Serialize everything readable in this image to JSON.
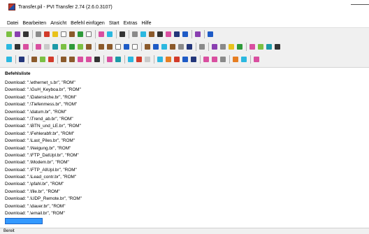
{
  "window": {
    "title": "Transfer.pil - PVI Transfer 2.74 (2.6.0.3107)",
    "app_icon": "pvi-transfer-icon"
  },
  "menubar": {
    "items": [
      "Datei",
      "Bearbeiten",
      "Ansicht",
      "Befehl einfügen",
      "Start",
      "Extras",
      "Hilfe"
    ]
  },
  "toolbars": {
    "row1": [
      "new-file-icon",
      "open-folder-icon",
      "save-icon",
      "sep",
      "cut-icon",
      "copy-icon",
      "paste-icon",
      "check-icon",
      "delete-icon",
      "undo-icon",
      "enter-icon",
      "sep",
      "insert-plus-icon",
      "insert-minus-icon",
      "sep",
      "print-icon",
      "sep",
      "stop-icon",
      "warning-icon",
      "circle-check-icon",
      "pencil-icon",
      "network-icon",
      "connect-icon",
      "connect-alt-icon",
      "sep",
      "help-icon",
      "sep",
      "question-icon"
    ],
    "row2": [
      "tool-a-icon",
      "tool-b-icon",
      "tool-c-icon",
      "sep",
      "down-arrow-icon",
      "up-arrow-icon",
      "home-icon",
      "warning-triangle-icon",
      "bar-chart-icon",
      "wrench-icon",
      "file-bl-icon",
      "sep",
      "refresh-icon",
      "sync-icon",
      "search-icon",
      "stop-red-icon",
      "chat-icon",
      "sep",
      "run-icon",
      "grid-icon",
      "pie-icon",
      "user-icon",
      "layers-icon",
      "tag-icon",
      "sep",
      "star-icon",
      "sep",
      "frame-a-icon",
      "frame-b-icon",
      "frame-c-icon",
      "frame-d-icon",
      "sep",
      "check-green-icon",
      "check-yellow-icon",
      "key-icon",
      "magic-icon"
    ],
    "row3": [
      "module-icon",
      "sep",
      "monitor-icon",
      "sep",
      "lock-icon",
      "boxes-icon",
      "bolt-icon",
      "sep",
      "image-icon",
      "document-icon",
      "chart-icon",
      "layers-alt-icon",
      "network-tree-icon",
      "sep",
      "connect-a-icon",
      "connect-b-icon",
      "sep",
      "email-icon",
      "timer-icon",
      "ip-icon",
      "sep",
      "variable-icon",
      "window-icon",
      "nc-icon",
      "blocks-icon",
      "arrows-icon",
      "sep",
      "list-icon",
      "sort-icon",
      "check-mark-icon",
      "sep",
      "p-icon",
      "flag-icon",
      "sep",
      "table-icon"
    ]
  },
  "command_list": {
    "header": "Befehlsliste",
    "items": [
      "Download: \".\\ethernet_s.br\", \"ROM\"",
      "Download: \".\\GuH_Keyboa.br\", \"ROM\"",
      "Download: \".\\Datensiche.br\", \"ROM\"",
      "Download: \".\\Tiefenmess.br\", \"ROM\"",
      "Download: \".\\datum.br\", \"ROM\"",
      "Download: \".\\Trend_ab.br\", \"ROM\"",
      "Download: \".\\BTN_und_LE.br\", \"ROM\"",
      "Download: \".\\Fehlerabfr.br\", \"ROM\"",
      "Download: \".\\Last_Piles.br\", \"ROM\"",
      "Download: \".\\Neigung.br\", \"ROM\"",
      "Download: \".\\FTP_DatUpl.br\", \"ROM\"",
      "Download: \".\\Modem.br\", \"ROM\"",
      "Download: \".\\FTP_AllUpl.br\", \"ROM\"",
      "Download: \".\\Lead_contr.br\", \"ROM\"",
      "Download: \".\\pfahl.br\", \"ROM\"",
      "Download: \".\\file.br\", \"ROM\"",
      "Download: \".\\UDP_Remote.br\", \"ROM\"",
      "Download: \".\\dauer.br\", \"ROM\"",
      "Download: \".\\email.br\", \"ROM\""
    ]
  },
  "statusbar": {
    "text": "Bereit"
  },
  "colors": {
    "selection": "#3399ff",
    "toolbar_bg": "#f0f0f0"
  }
}
